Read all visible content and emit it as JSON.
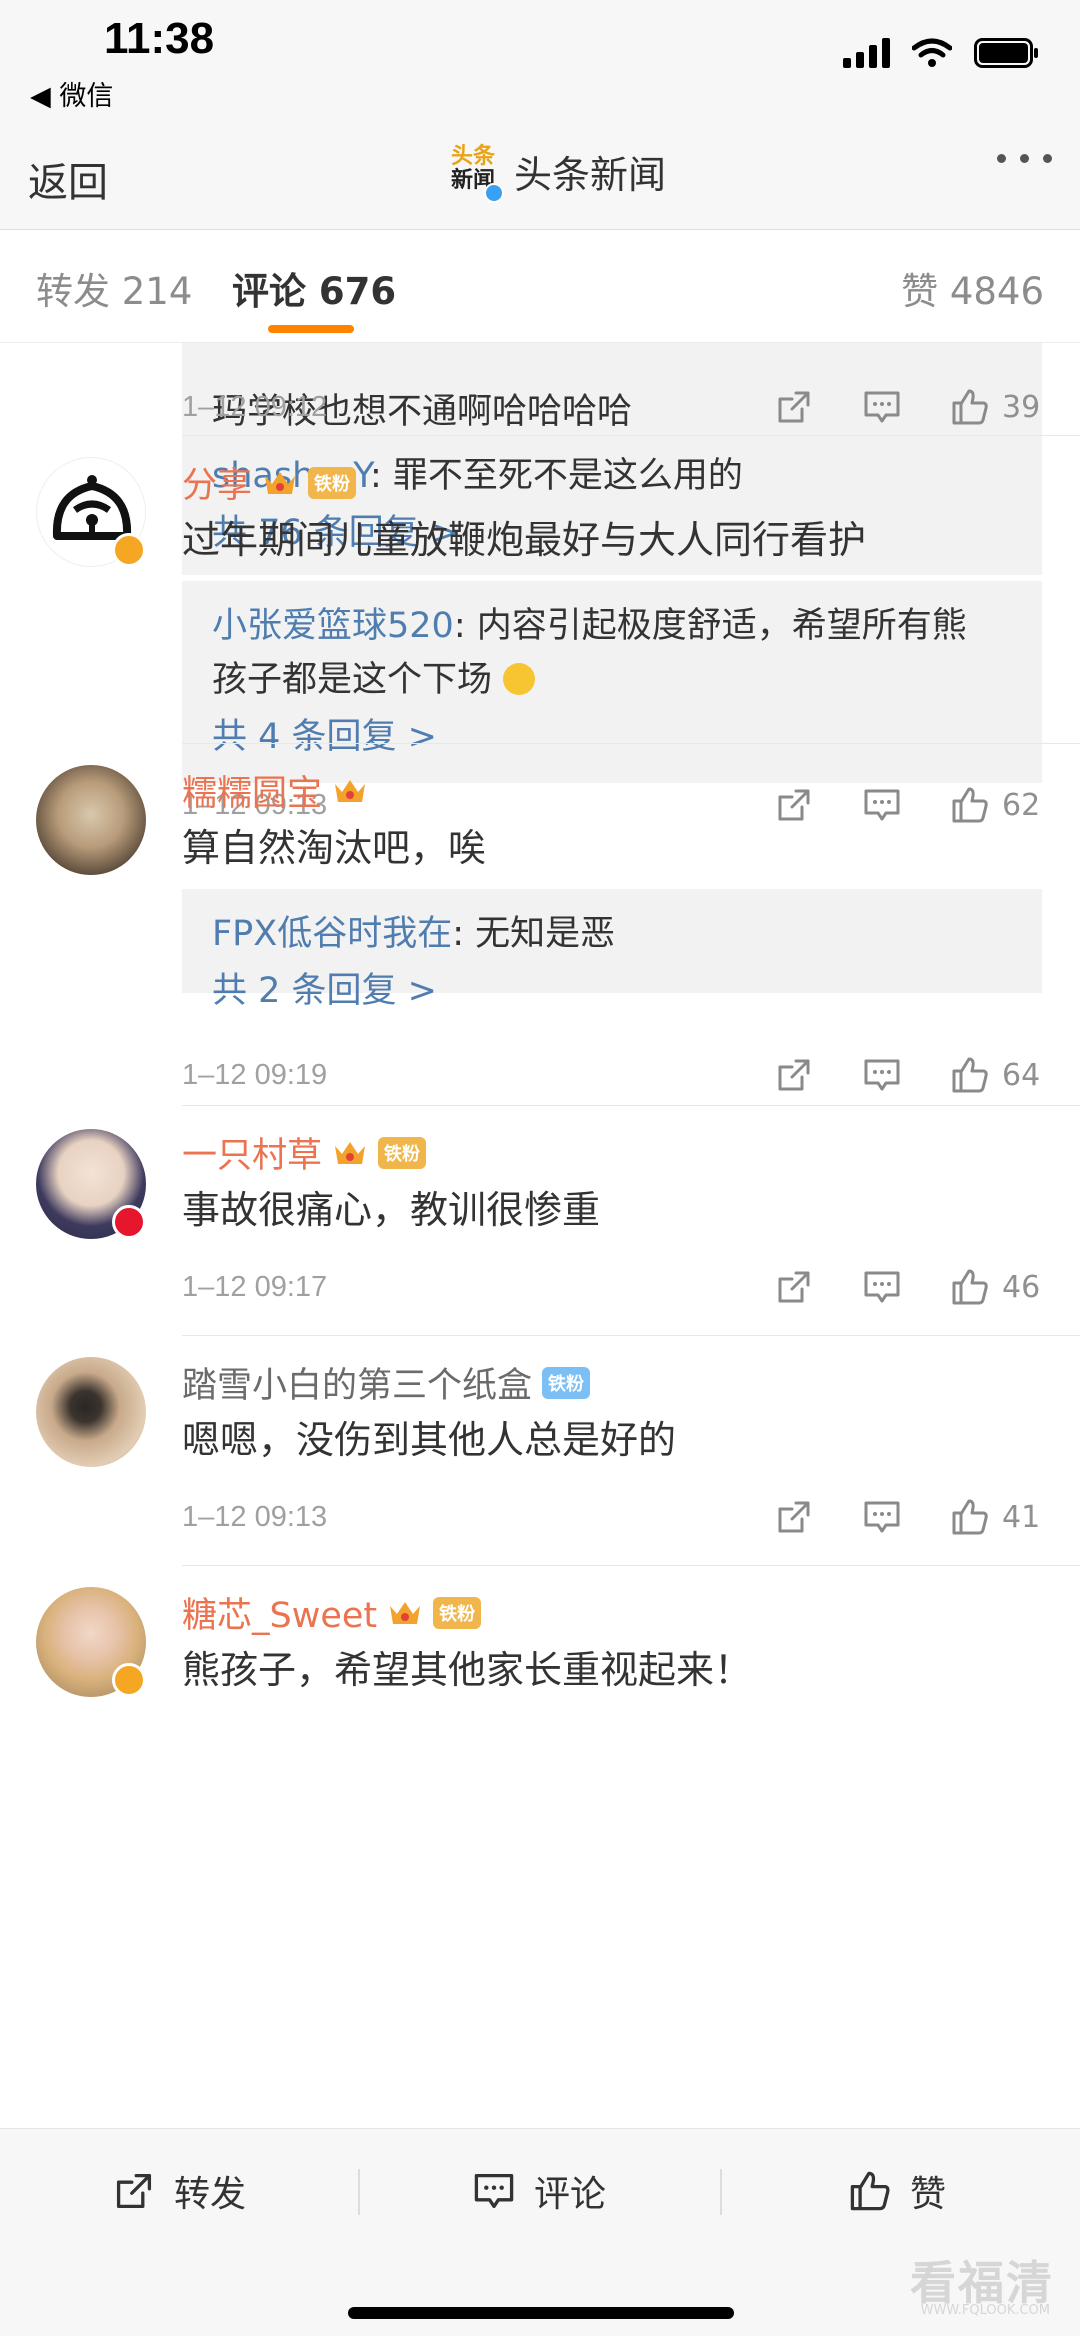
{
  "status_bar": {
    "time": "11:38",
    "back_app": "◀ 微信"
  },
  "nav": {
    "back": "返回",
    "logo_text_line1": "头条",
    "logo_text_line2": "新闻",
    "title": "头条新闻"
  },
  "tabs": {
    "repost": "转发 214",
    "comments": "评论 676",
    "likes": "赞 4846"
  },
  "comments": [
    {
      "partial_text_line": "玛学校也想不通啊哈哈哈哈",
      "reply": {
        "user": "shasha_Y",
        "text": ": 罪不至死不是这么用的"
      },
      "reply_more": "共 76 条回复 >",
      "time": "1–12 09:12",
      "likes": "39"
    },
    {
      "username": "分享",
      "badge": "铁粉",
      "text": "过年期间儿童放鞭炮最好与大人同行看护",
      "reply": {
        "user": "小张爱篮球520",
        "text": ": 内容引起极度舒适，希望所有熊",
        "text2": "孩子都是这个下场"
      },
      "reply_more": "共 4 条回复 >",
      "time": "1–12 09:13",
      "likes": "62"
    },
    {
      "username": "糯糯圆宝",
      "text": "算自然淘汰吧，唉",
      "reply": {
        "user": "FPX低谷时我在",
        "text": ": 无知是恶"
      },
      "reply_more": "共 2 条回复 >",
      "time": "1–12 09:19",
      "likes": "64"
    },
    {
      "username": "一只村草",
      "badge": "铁粉",
      "text": "事故很痛心，教训很惨重",
      "time": "1–12 09:17",
      "likes": "46"
    },
    {
      "username": "踏雪小白的第三个纸盒",
      "badge": "铁粉",
      "text": "嗯嗯，没伤到其他人总是好的",
      "time": "1–12 09:13",
      "likes": "41"
    },
    {
      "username": "糖芯_Sweet",
      "badge": "铁粉",
      "text": "熊孩子，希望其他家长重视起来！"
    }
  ],
  "toolbar": {
    "repost": "转发",
    "comment": "评论",
    "like": "赞"
  },
  "watermark": {
    "main": "看福清",
    "sub": "WWW.FQLOOK.COM"
  },
  "colors": {
    "accent": "#ff8200",
    "username": "#eb7350",
    "reply_link": "#507daf",
    "verified_gold": "#f5a623",
    "verified_red": "#e6162d"
  }
}
